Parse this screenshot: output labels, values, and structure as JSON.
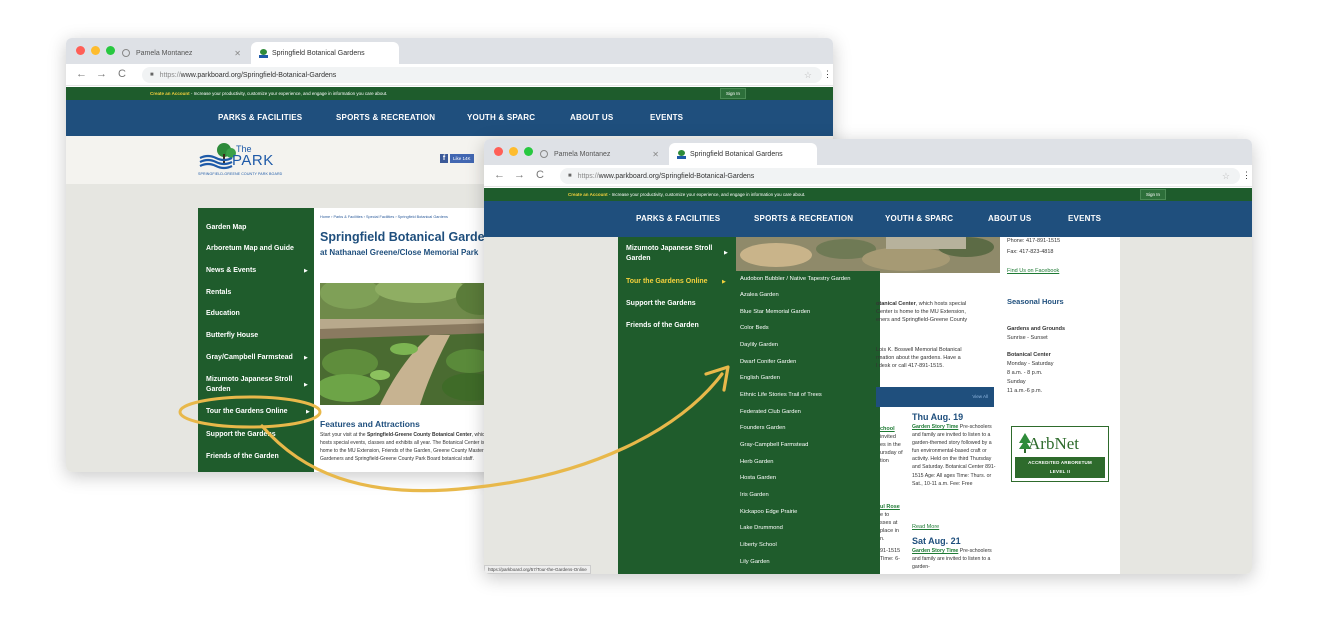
{
  "browser": {
    "tab_profile": "Pamela Montanez",
    "tab_active": "Springfield Botanical Gardens",
    "url_scheme": "https://",
    "url_host": "www.parkboard.org/Springfield-Botanical-Gardens",
    "status_url": "https://parkboard.org/57/Tour-the-Gardens-Online"
  },
  "topbar": {
    "create_account": "Create an Account",
    "create_account_text": " - Increase your productivity, customize your experience, and engage in information you care about.",
    "sign_in": "Sign In"
  },
  "nav": {
    "items": [
      "PARKS & FACILITIES",
      "SPORTS & RECREATION",
      "YOUTH & SPARC",
      "ABOUT US",
      "EVENTS"
    ]
  },
  "logo": {
    "the": "The",
    "park": "PARK",
    "tagline": "SPRINGFIELD-GREENE COUNTY PARK BOARD"
  },
  "facebook": {
    "like": "Like",
    "count": "14K"
  },
  "sidebar": {
    "items": [
      "Garden Map",
      "Arboretum Map and Guide",
      "News & Events",
      "Rentals",
      "Education",
      "Butterfly House",
      "Gray/Campbell Farmstead",
      "Mizumoto Japanese Stroll Garden",
      "Tour the Gardens Online",
      "Support the Gardens",
      "Friends of the Garden"
    ]
  },
  "page": {
    "breadcrumb": "Home › Parks & Facilities › Special Facilities › Springfield Botanical Gardens",
    "title": "Springfield Botanical Gardens",
    "subtitle": "at Nathanael Greene/Close Memorial Park",
    "features_heading": "Features and Attractions",
    "features_text_1": "Start your visit at the",
    "features_link": "Springfield-Greene County Botanical Center",
    "features_text_2": ", which hosts special events, classes and exhibits all year. The Botanical Center is home to the MU Extension, Friends of the Garden, Greene County Master Gardeners and Springfield-Greene County Park Board botanical staff.",
    "library_text": "Lois K. Boswell Memorial Botanical",
    "info_text": "rmation about the gardens. Have a",
    "desk_text": "l desk or call 417-891-1515."
  },
  "contact": {
    "phone": "Phone: 417-891-1515",
    "fax": "Fax: 417-823-4818",
    "facebook_link": "Find Us on Facebook"
  },
  "hours": {
    "heading": "Seasonal Hours",
    "gardens_label": "Gardens and Grounds",
    "gardens_hours": "Sunrise - Sunset",
    "center_label": "Botanical Center",
    "center_days": "Monday - Saturday",
    "center_hours": "8 a.m. - 8 p.m.",
    "sunday_label": "Sunday",
    "sunday_hours": "11 a.m.-6 p.m."
  },
  "events": {
    "view_all": "View All",
    "date_1": "Thu Aug. 19",
    "event_1_title": "Garden Story Time",
    "event_1_desc": " Pre-schoolers and family are invited to listen to a garden-themed story followed by a fun environmental-based craft or activity. Held on the third Thursday and Saturday. Botanical Center 891-1515 Age: All ages Time: Thurs. or Sat., 10-11 a.m. Fee: Free",
    "read_more": "Read More",
    "date_2": "Sat Aug. 21",
    "event_2_title": "Garden Story Time",
    "event_2_desc": " Pre-schoolers and family are invited to listen to a garden-",
    "left_frag_1": "chool",
    "left_frag_2": "invited",
    "left_frag_3": "es in the",
    "left_frag_4": "ursday of",
    "left_frag_5": "tion",
    "left_frag_6": "ul Rose",
    "left_frag_7": "e to",
    "left_frag_8": "sses at",
    "left_frag_9": "place in",
    "left_frag_10": "n.",
    "left_frag_11": "91-1515",
    "left_frag_12": "Time: 6-"
  },
  "arbnet": {
    "name": "ArbNet",
    "line1": "ACCREDITED ARBORETUM",
    "line2": "LEVEL II"
  },
  "submenu": {
    "items": [
      "Audobon Bubbler / Native Tapestry Garden",
      "Azalea Garden",
      "Blue Star Memorial Garden",
      "Color Beds",
      "Daylily Garden",
      "Dwarf Conifer Garden",
      "English Garden",
      "Ethnic Life Stories Trail of Trees",
      "Federated Club Garden",
      "Founders Garden",
      "Gray-Campbell Farmstead",
      "Herb Garden",
      "Hosta Garden",
      "Iris Garden",
      "Kickapoo Edge Prairie",
      "Lake Drummond",
      "Liberty School",
      "Lily Garden"
    ]
  },
  "colors": {
    "nav_blue": "#1f4f7d",
    "sidebar_green": "#1f5c2c",
    "highlight_yellow": "#f4d13d",
    "annotation_gold": "#e8b84a"
  }
}
